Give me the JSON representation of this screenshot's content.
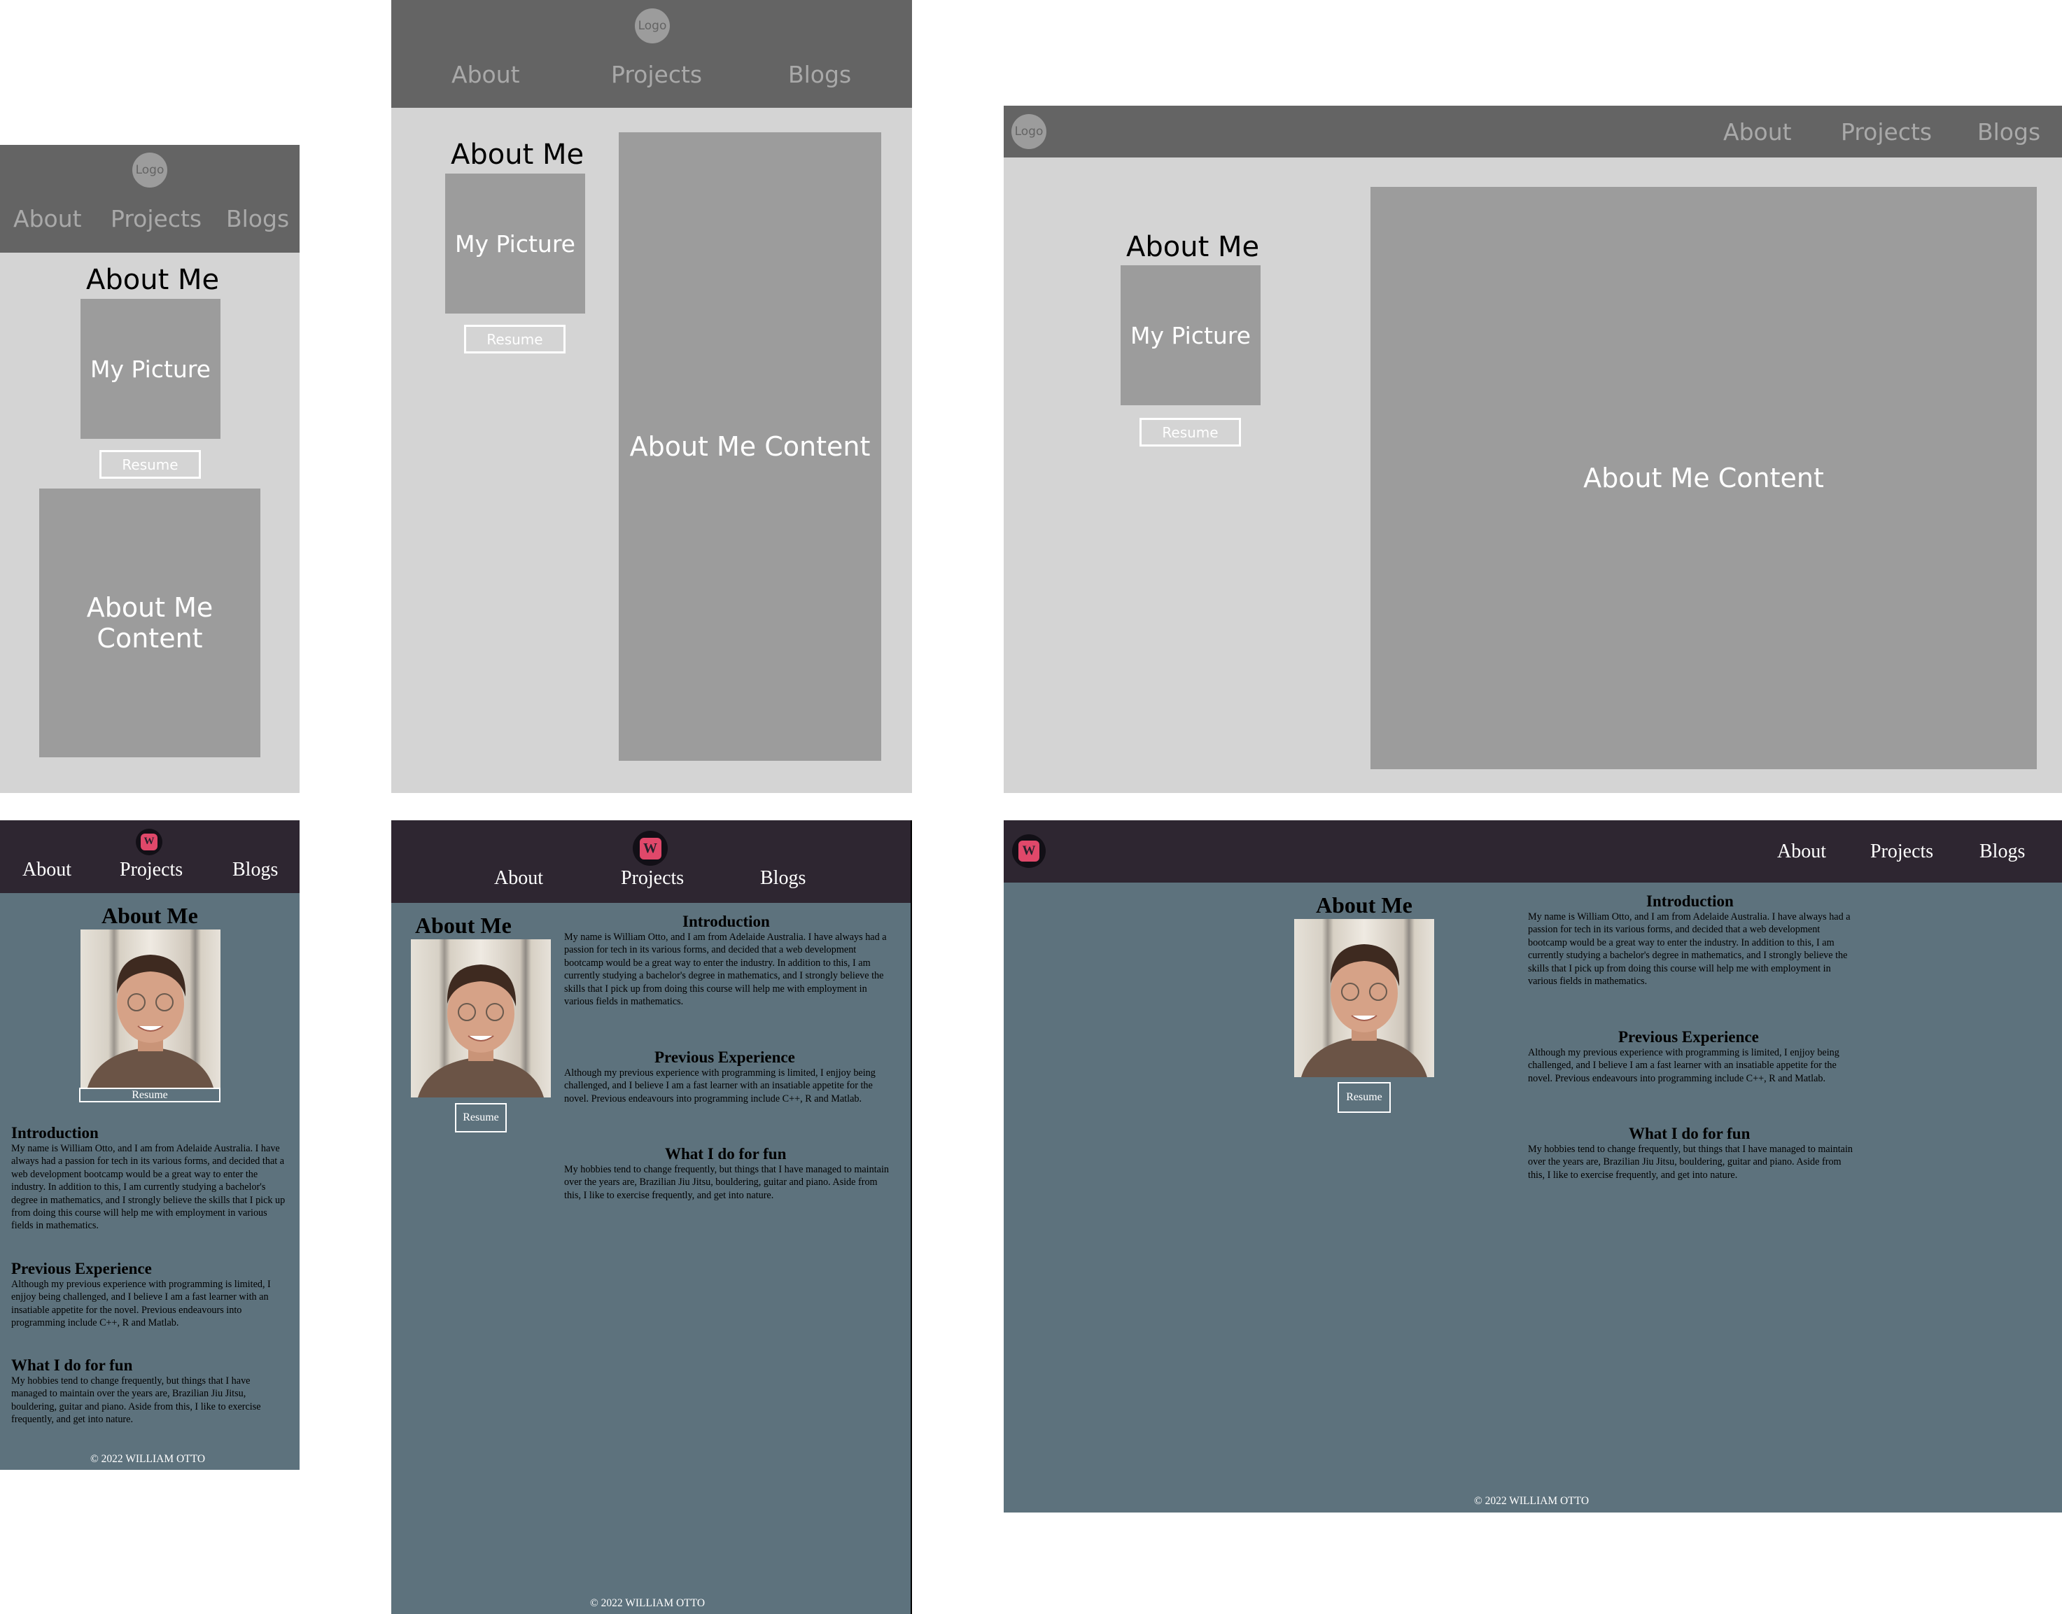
{
  "wireframe": {
    "logo": "Logo",
    "nav": {
      "about": "About",
      "projects": "Projects",
      "blogs": "Blogs"
    },
    "about_title": "About Me",
    "picture_label": "My Picture",
    "resume_label": "Resume",
    "content_label": "About Me Content"
  },
  "site": {
    "logo_letter": "W",
    "nav": {
      "about": "About",
      "projects": "Projects",
      "blogs": "Blogs"
    },
    "about_title": "About Me",
    "resume_label": "Resume",
    "sections": {
      "intro_title": "Introduction",
      "intro_text": "My name is William Otto, and I am from Adelaide Australia. I have always had a passion for tech in its various forms, and decided that a web development bootcamp would be a great way to enter the industry. In addition to this, I am currently studying a bachelor's degree in mathematics, and I strongly believe the skills that I pick up from doing this course will help me with employment in various fields in mathematics.",
      "experience_title": "Previous Experience",
      "experience_text": "Although my previous experience with programming is limited, I enjjoy being challenged, and I believe I am a fast learner with an insatiable appetite for the novel. Previous endeavours into programming include C++, R and Matlab.",
      "fun_title": "What I do for fun",
      "fun_text": "My hobbies tend to change frequently, but things that I have managed to maintain over the years are, Brazilian Jiu Jitsu, bouldering, guitar and piano. Aside from this, I like to exercise frequently, and get into nature."
    },
    "footer": "© 2022 WILLIAM OTTO"
  },
  "colors": {
    "wireframe_nav": "#646464",
    "wireframe_body": "#d4d4d4",
    "wireframe_box": "#9c9c9c",
    "site_nav": "#2e2631",
    "site_body": "#5d727d",
    "logo_accent": "#e0486a"
  }
}
